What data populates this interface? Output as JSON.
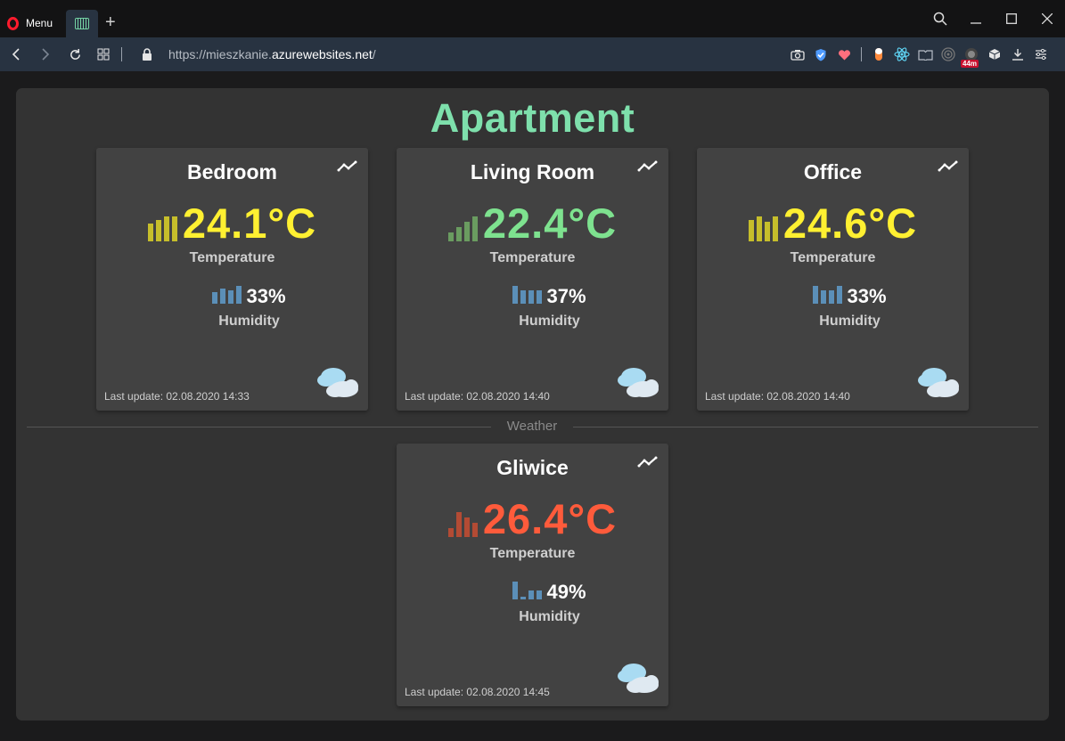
{
  "browser": {
    "menu_label": "Menu",
    "new_tab": "+",
    "url_scheme": "https://mieszkanie.",
    "url_host": "azurewebsites.net",
    "url_path": "/",
    "badge": "44m"
  },
  "page": {
    "title": "Apartment",
    "divider_label": "Weather",
    "temperature_label": "Temperature",
    "humidity_label": "Humidity"
  },
  "colors": {
    "title": "#7ee0ac",
    "yellow": "#fff031",
    "green": "#7ee28f",
    "red": "#ff5b3b",
    "humidity_bars": "#5b8fb8"
  },
  "rooms": [
    {
      "name": "Bedroom",
      "temperature": "24.1°C",
      "temp_color": "yellow",
      "humidity": "33%",
      "last_update": "Last update: 02.08.2020 14:33",
      "icon": "partly-cloudy-icon"
    },
    {
      "name": "Living Room",
      "temperature": "22.4°C",
      "temp_color": "green",
      "humidity": "37%",
      "last_update": "Last update: 02.08.2020 14:40",
      "icon": "partly-cloudy-icon"
    },
    {
      "name": "Office",
      "temperature": "24.6°C",
      "temp_color": "yellow",
      "humidity": "33%",
      "last_update": "Last update: 02.08.2020 14:40",
      "icon": "partly-cloudy-icon"
    }
  ],
  "weather": [
    {
      "name": "Gliwice",
      "temperature": "26.4°C",
      "temp_color": "red",
      "humidity": "49%",
      "last_update": "Last update: 02.08.2020 14:45",
      "icon": "partly-cloudy-icon"
    }
  ]
}
